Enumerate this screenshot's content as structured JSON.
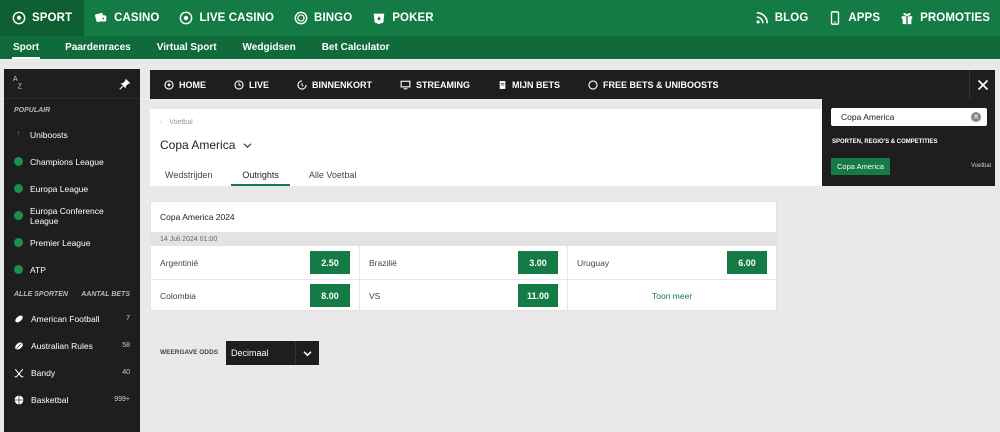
{
  "topnav": {
    "left": [
      {
        "label": "Sport",
        "icon": "soccer-ball-icon",
        "active": true
      },
      {
        "label": "Casino",
        "icon": "dice-icon"
      },
      {
        "label": "Live Casino",
        "icon": "roulette-icon"
      },
      {
        "label": "Bingo",
        "icon": "bingo-ball-icon"
      },
      {
        "label": "Poker",
        "icon": "poker-chip-icon"
      }
    ],
    "right": [
      {
        "label": "Blog",
        "icon": "rss-icon"
      },
      {
        "label": "Apps",
        "icon": "phone-icon"
      },
      {
        "label": "Promoties",
        "icon": "gift-icon"
      }
    ]
  },
  "subnav": {
    "items": [
      "Sport",
      "Paardenraces",
      "Virtual Sport",
      "Wedgidsen",
      "Bet Calculator"
    ]
  },
  "sidebar": {
    "sort_label": "AZ",
    "popular_heading": "Populair",
    "popular": [
      {
        "label": "Uniboosts",
        "icon": "boost-arrow-icon"
      },
      {
        "label": "Champions League",
        "icon": "globe-icon"
      },
      {
        "label": "Europa League",
        "icon": "globe-icon"
      },
      {
        "label": "Europa Conference League",
        "icon": "globe-icon"
      },
      {
        "label": "Premier League",
        "icon": "globe-icon"
      },
      {
        "label": "ATP",
        "icon": "globe-icon"
      }
    ],
    "all_heading": "Alle sporten",
    "count_heading": "Aantal bets",
    "sports": [
      {
        "label": "American Football",
        "count": "7",
        "icon": "american-football-icon"
      },
      {
        "label": "Australian Rules",
        "count": "58",
        "icon": "rugby-ball-icon"
      },
      {
        "label": "Bandy",
        "count": "40",
        "icon": "bandy-sticks-icon"
      },
      {
        "label": "Basketbal",
        "count": "999+",
        "icon": "basketball-icon"
      }
    ]
  },
  "mainbar": {
    "items": [
      {
        "label": "Home",
        "icon": "soccer-ball-icon"
      },
      {
        "label": "Live",
        "icon": "clock-icon"
      },
      {
        "label": "Binnenkort",
        "icon": "timer-icon"
      },
      {
        "label": "Streaming",
        "icon": "monitor-icon"
      },
      {
        "label": "Mijn Bets",
        "icon": "betslip-icon"
      },
      {
        "label": "Free Bets & Uniboosts",
        "icon": "circle-icon"
      }
    ]
  },
  "search": {
    "value": "Copa America",
    "heading": "Sporten, regio's & competities",
    "result": "Copa America",
    "result_category": "Voetbal"
  },
  "header": {
    "breadcrumb": "Voetbal",
    "title": "Copa America",
    "tabs": [
      "Wedstrijden",
      "Outrights",
      "Alle Voetbal"
    ]
  },
  "outright": {
    "title": "Copa America 2024",
    "date": "14 Juli 2024 01:00",
    "selections": [
      {
        "name": "Argentinië",
        "odds": "2.50"
      },
      {
        "name": "Brazilië",
        "odds": "3.00"
      },
      {
        "name": "Uruguay",
        "odds": "6.00"
      },
      {
        "name": "Colombia",
        "odds": "8.00"
      },
      {
        "name": "VS",
        "odds": "11.00"
      }
    ],
    "more_label": "Toon meer"
  },
  "odds_format": {
    "label": "Weergave odds",
    "value": "Decimaal"
  }
}
